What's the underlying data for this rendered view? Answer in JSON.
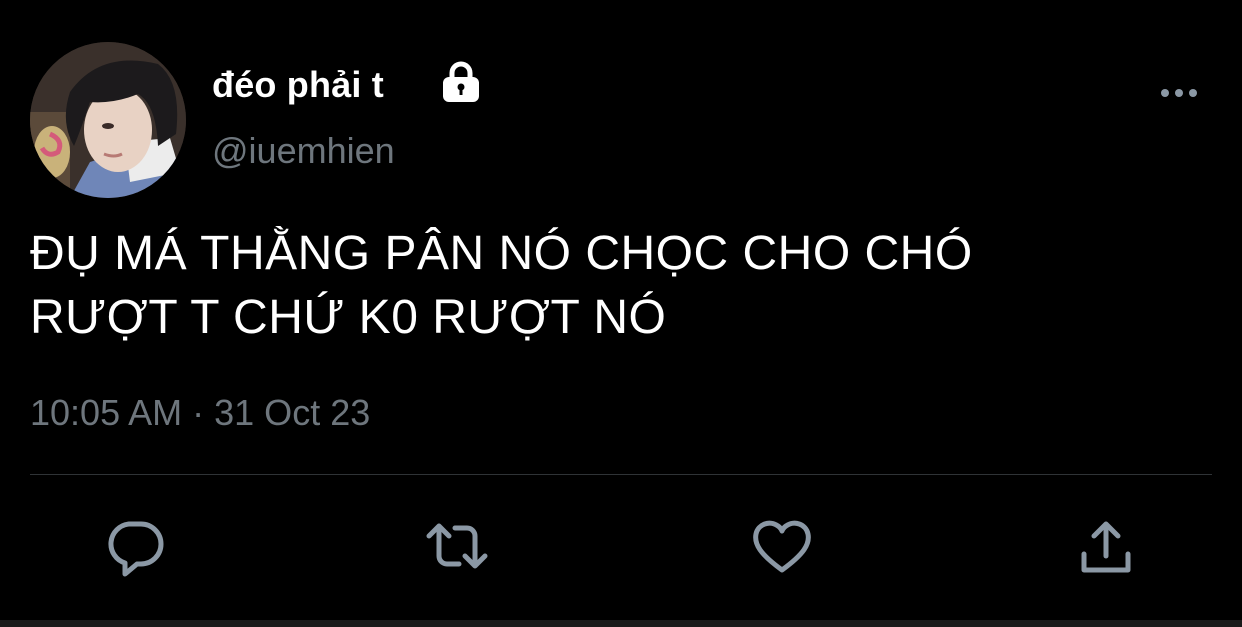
{
  "user": {
    "display_name": "đéo phải t",
    "handle": "@iuemhien",
    "protected": true
  },
  "tweet": {
    "text_lines": [
      "ĐỤ MÁ THẰNG PÂN NÓ CHỌC CHO CHÓ",
      "RƯỢT T CHỨ K0 RƯỢT NÓ"
    ],
    "time": "10:05 AM",
    "separator": "·",
    "date": "31 Oct 23"
  },
  "icons": {
    "lock": "lock-icon",
    "more": "more-horizontal-icon",
    "reply": "reply-icon",
    "retweet": "retweet-icon",
    "like": "heart-icon",
    "share": "share-icon"
  },
  "colors": {
    "background": "#000000",
    "text_primary": "#ffffff",
    "text_secondary": "#6e767d",
    "icon": "#8b98a5",
    "divider": "#2f3336"
  }
}
